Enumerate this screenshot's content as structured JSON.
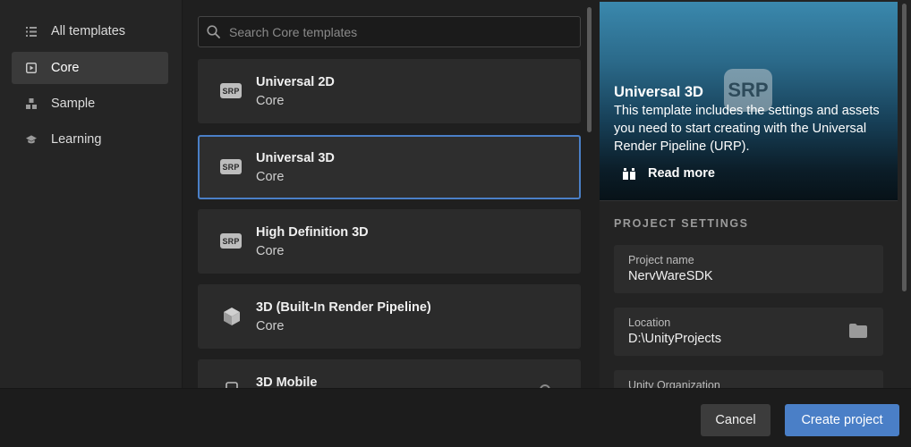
{
  "sidebar": {
    "items": [
      {
        "label": "All templates",
        "icon": "list-icon",
        "active": false
      },
      {
        "label": "Core",
        "icon": "play-square-icon",
        "active": true
      },
      {
        "label": "Sample",
        "icon": "shapes-icon",
        "active": false
      },
      {
        "label": "Learning",
        "icon": "graduation-cap-icon",
        "active": false
      }
    ]
  },
  "search": {
    "placeholder": "Search Core templates",
    "value": ""
  },
  "templates": [
    {
      "title": "Universal 2D",
      "category": "Core",
      "badge": "SRP",
      "selected": false
    },
    {
      "title": "Universal 3D",
      "category": "Core",
      "badge": "SRP",
      "selected": true
    },
    {
      "title": "High Definition 3D",
      "category": "Core",
      "badge": "SRP",
      "selected": false
    },
    {
      "title": "3D (Built-In Render Pipeline)",
      "category": "Core",
      "icon": "cube-icon",
      "selected": false
    },
    {
      "title": "3D Mobile",
      "category": "",
      "icon": "phone-icon",
      "selected": false
    }
  ],
  "details": {
    "hero_badge": "SRP",
    "title": "Universal 3D",
    "description": "This template includes the settings and assets you need to start creating with the Universal Render Pipeline (URP).",
    "read_more": "Read more",
    "section_title": "PROJECT SETTINGS",
    "project_name_label": "Project name",
    "project_name_value": "NervWareSDK",
    "location_label": "Location",
    "location_value": "D:\\UnityProjects",
    "org_label": "Unity Organization"
  },
  "footer": {
    "cancel_label": "Cancel",
    "create_label": "Create project"
  },
  "colors": {
    "accent": "#4a7fc7",
    "background": "#1f1f1f",
    "card": "#2b2b2b"
  }
}
